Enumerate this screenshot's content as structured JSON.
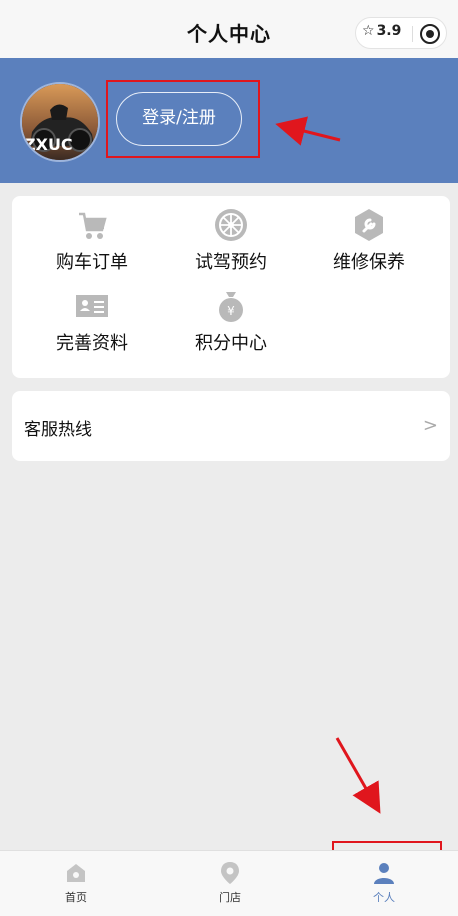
{
  "header": {
    "title": "个人中心",
    "rating": "3.9",
    "star_glyph": "☆"
  },
  "profile": {
    "login_label": "登录/注册",
    "avatar_text": "ZXUC"
  },
  "menu": [
    {
      "label": "购车订单",
      "icon": "cart-icon"
    },
    {
      "label": "试驾预约",
      "icon": "steering-wheel-icon"
    },
    {
      "label": "维修保养",
      "icon": "wrench-icon"
    },
    {
      "label": "完善资料",
      "icon": "id-card-icon"
    },
    {
      "label": "积分中心",
      "icon": "money-bag-icon"
    }
  ],
  "service": {
    "label": "客服热线",
    "arrow": ">"
  },
  "tabs": [
    {
      "label": "首页",
      "icon": "home-icon"
    },
    {
      "label": "门店",
      "icon": "location-pin-icon"
    },
    {
      "label": "个人",
      "icon": "person-icon",
      "active": true
    }
  ],
  "colors": {
    "banner": "#5b80bd",
    "highlight": "#e0161d",
    "icon_gray": "#b9b9b9",
    "active_tab": "#5b80bd"
  }
}
